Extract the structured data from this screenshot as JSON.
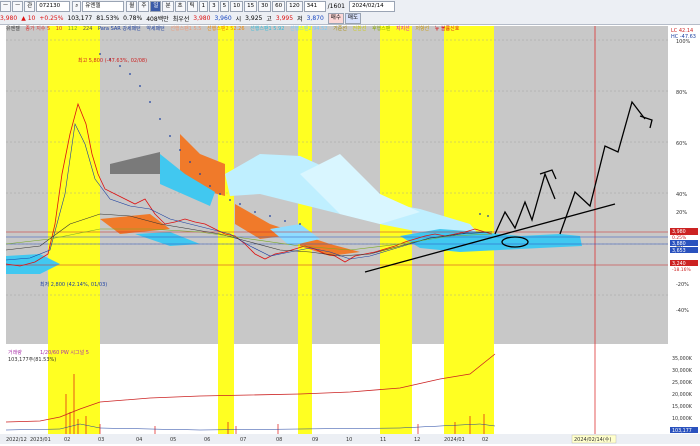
{
  "toolbar": {
    "row1": {
      "mode_buttons": [
        "ㅡ",
        "ㅡ",
        "관"
      ],
      "code": "072130",
      "search_icon": "search-icon",
      "stock_name": "유엔젤",
      "periods": [
        "월",
        "주",
        "일",
        "분",
        "초",
        "틱"
      ],
      "intervals": [
        "1",
        "3",
        "5",
        "10",
        "15",
        "30",
        "60",
        "120"
      ],
      "count_value": "341",
      "count_total": "/1601",
      "date": "2024/02/14",
      "buy_label": "매수",
      "sell_label": "매도"
    },
    "row2": {
      "price": "3,980",
      "change": "▲ 10",
      "change_pct": "+0.25%",
      "volume": "103,177",
      "vol_ratio": "81.53%",
      "turnover": "0.78%",
      "amount": "408백만",
      "priority": "최우선",
      "open": "3,980",
      "open2": "3,960",
      "high_label": "시",
      "high": "3,925",
      "low_label": "고",
      "low": "3,995",
      "close_label": "저",
      "close": "3,870"
    }
  },
  "legend": [
    {
      "text": "유엔젤",
      "color": "#333"
    },
    {
      "text": "종가 지수 5",
      "color": "#d33"
    },
    {
      "text": "10",
      "color": "#d33"
    },
    {
      "text": "112",
      "color": "#7a2"
    },
    {
      "text": "224",
      "color": "#555"
    },
    {
      "text": "Para SAR 강세패턴",
      "color": "#1b3fa0"
    },
    {
      "text": "약세패턴",
      "color": "#1b3fa0"
    },
    {
      "text": "선행스팬1 5.5",
      "color": "#e97"
    },
    {
      "text": "선행스팬2 52.26",
      "color": "#e80"
    },
    {
      "text": "선행스팬1 5.92",
      "color": "#3bd"
    },
    {
      "text": "선행스팬2 94.52",
      "color": "#7cf"
    },
    {
      "text": "기준선",
      "color": "#a80"
    },
    {
      "text": "전환선",
      "color": "#cc0"
    },
    {
      "text": "후행스팬",
      "color": "#8a0"
    },
    {
      "text": "지지선",
      "color": "#d0d"
    },
    {
      "text": "저항선",
      "color": "#c90"
    },
    {
      "text": "뉴 볼륨신호",
      "color": "#d11"
    }
  ],
  "annotations": {
    "high": "최고 5,800 (-47.63%, 02/08)",
    "low": "최저 2,800 (42.14%, 01/03)"
  },
  "right_axis": {
    "top_labels": [
      "LC 42.14",
      "HC -47.63"
    ],
    "pct": [
      "100%",
      "80%",
      "60%",
      "40%",
      "20%",
      "0%",
      "-20%",
      "-40%"
    ],
    "price_tags": [
      {
        "value": "3,980",
        "pct": "0.25%",
        "color": "#c22"
      },
      {
        "value": "3,880",
        "color": "#2a52be"
      },
      {
        "value": "3,653",
        "color": "#2a52be"
      },
      {
        "value": "3,240",
        "pct": "-18.16%",
        "color": "#c22"
      }
    ],
    "volume_labels": [
      "35,000K",
      "30,000K",
      "25,000K",
      "20,000K",
      "15,000K",
      "10,000K",
      "5,000K"
    ],
    "vol_current": "103,177"
  },
  "volume_legend": {
    "text": "거래량",
    "ma": "1/20/60 PW 시그널 5",
    "value": "103,177주(81.53%)"
  },
  "x_axis": {
    "labels": [
      "2022/12",
      "2023/01",
      "02",
      "03",
      "04",
      "05",
      "06",
      "07",
      "08",
      "09",
      "10",
      "11",
      "12",
      "2024/01",
      "02"
    ],
    "cursor_date": "2024/02/14(수)"
  }
}
